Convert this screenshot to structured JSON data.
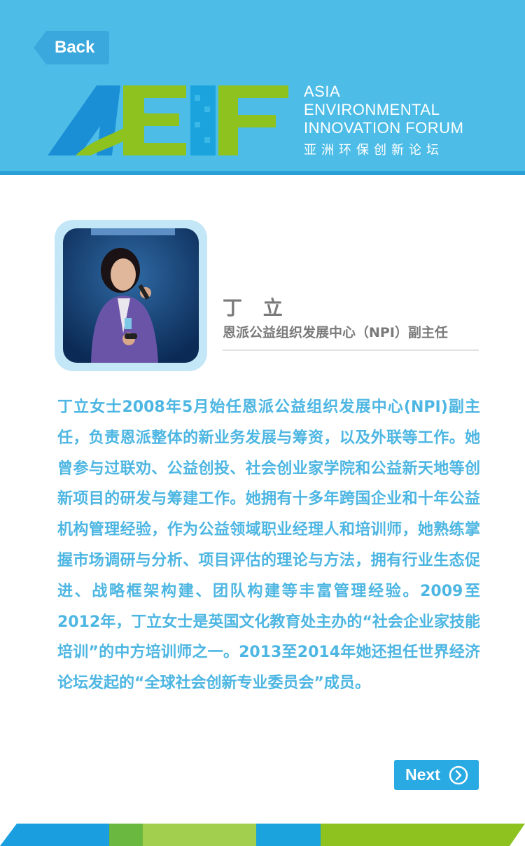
{
  "header": {
    "back_label": "Back",
    "logo_alt": "AEIF",
    "logo_lines": [
      "ASIA",
      "ENVIRONMENTAL",
      "INNOVATION FORUM"
    ],
    "logo_cn": "亚洲环保创新论坛",
    "bg_color": "#4dbde8"
  },
  "profile": {
    "name": "丁 立",
    "role": "恩派公益组织发展中心（NPI）副主任"
  },
  "bio": "丁立女士2008年5月始任恩派公益组织发展中心(NPI)副主任，负责恩派整体的新业务发展与筹资，以及外联等工作。她曾参与过联劝、公益创投、社会创业家学院和公益新天地等创新项目的研发与筹建工作。她拥有十多年跨国企业和十年公益机构管理经验，作为公益领域职业经理人和培训师，她熟练掌握市场调研与分析、项目评估的理论与方法，拥有行业生态促进、战略框架构建、团队构建等丰富管理经验。2009至2012年，丁立女士是英国文化教育处主办的“社会企业家技能培训”的中方培训师之一。2013至2014年她还担任世界经济论坛发起的“全球社会创新专业委员会”成员。",
  "nav": {
    "next_label": "Next"
  },
  "colors": {
    "accent_blue": "#29aae2",
    "text_blue": "#4db6e2",
    "green": "#8dc21f"
  }
}
